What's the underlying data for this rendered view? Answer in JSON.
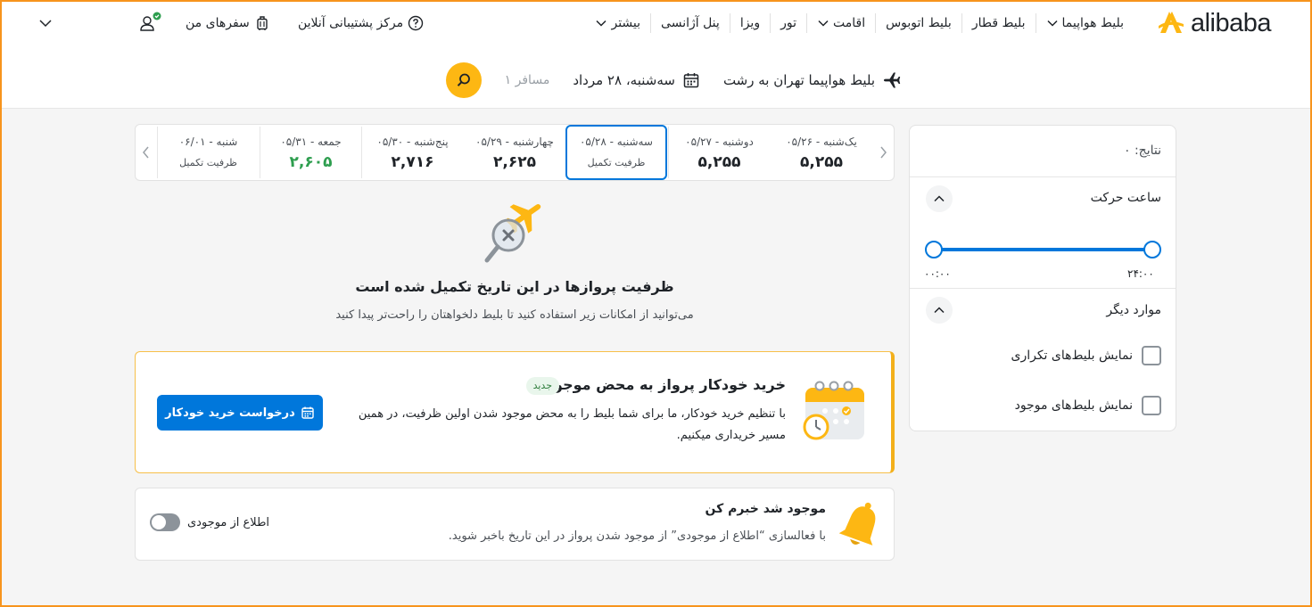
{
  "header": {
    "logo_text": "alibaba",
    "nav": [
      {
        "label": "بلیط هواپیما",
        "has_dropdown": true
      },
      {
        "label": "بلیط قطار",
        "has_dropdown": false
      },
      {
        "label": "بلیط اتوبوس",
        "has_dropdown": false
      },
      {
        "label": "اقامت",
        "has_dropdown": true
      },
      {
        "label": "تور",
        "has_dropdown": false
      },
      {
        "label": "ویزا",
        "has_dropdown": false
      },
      {
        "label": "پنل آژانسی",
        "has_dropdown": false
      },
      {
        "label": "بیشتر",
        "has_dropdown": true
      }
    ],
    "support_label": "مرکز پشتیبانی آنلاین",
    "trips_label": "سفرهای من"
  },
  "search_summary": {
    "route": "بلیط هواپیما تهران به رشت",
    "date": "سه‌شنبه، ۲۸ مرداد",
    "passengers": "۱ مسافر"
  },
  "date_strip": [
    {
      "label": "یک‌شنبه - ۰۵/۲۶",
      "price": "۵,۲۵۵",
      "state": "normal"
    },
    {
      "label": "دوشنبه - ۰۵/۲۷",
      "price": "۵,۲۵۵",
      "state": "normal"
    },
    {
      "label": "سه‌شنبه - ۰۵/۲۸",
      "full_text": "ظرفیت تکمیل",
      "state": "active"
    },
    {
      "label": "چهارشنبه - ۰۵/۲۹",
      "price": "۲,۶۲۵",
      "state": "normal"
    },
    {
      "label": "پنج‌شنبه - ۰۵/۳۰",
      "price": "۲,۷۱۶",
      "state": "normal"
    },
    {
      "label": "جمعه - ۰۵/۳۱",
      "price": "۲,۶۰۵",
      "state": "cheapest"
    },
    {
      "label": "شنبه - ۰۶/۰۱",
      "full_text": "ظرفیت تکمیل",
      "state": "full"
    }
  ],
  "empty_state": {
    "title": "ظرفیت پروازها در این تاریخ تکمیل شده است",
    "subtitle": "می‌توانید از امکانات زیر استفاده کنید تا بلیط دلخواهتان را راحت‌تر پیدا کنید"
  },
  "auto_purchase": {
    "title": "خرید خودکار پرواز به محض موجودی",
    "badge": "جدید",
    "description": "با تنظیم خرید خودکار، ما برای شما بلیط را به محض موجود شدن اولین ظرفیت، در همین مسیر خریداری میکنیم.",
    "button_label": "درخواست خرید خودکار"
  },
  "notify": {
    "title": "موجود شد خبرم کن",
    "description": "با فعالسازی “اطلاع از موجودی” از موجود شدن پرواز در این تاریخ باخبر شوید.",
    "toggle_label": "اطلاع از موجودی",
    "toggle_on": false
  },
  "sidebar": {
    "results_label": "نتایج: ۰",
    "departure_time": {
      "title": "ساعت حرکت",
      "range_min": "۰۰:۰۰",
      "range_max": "۲۴:۰۰"
    },
    "other_options": {
      "title": "موارد دیگر",
      "options": [
        {
          "label": "نمایش بلیط‌های تکراری",
          "checked": false
        },
        {
          "label": "نمایش بلیط‌های موجود",
          "checked": false
        }
      ]
    }
  },
  "colors": {
    "primary": "#0077db",
    "accent_yellow": "#fdb713",
    "cheapest_green": "#2e9e4f",
    "frame_orange": "#f7941d"
  }
}
